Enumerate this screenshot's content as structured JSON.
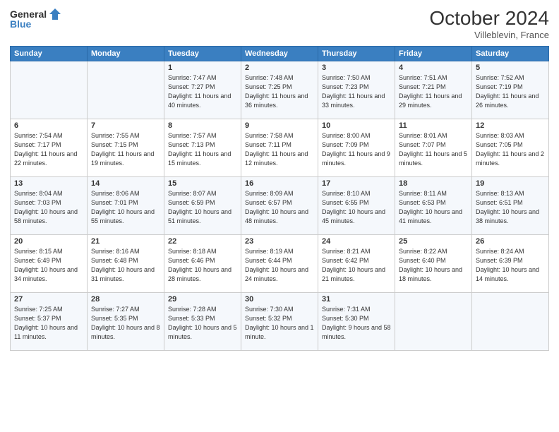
{
  "header": {
    "logo_line1": "General",
    "logo_line2": "Blue",
    "month": "October 2024",
    "location": "Villeblevin, France"
  },
  "weekdays": [
    "Sunday",
    "Monday",
    "Tuesday",
    "Wednesday",
    "Thursday",
    "Friday",
    "Saturday"
  ],
  "weeks": [
    [
      {
        "day": "",
        "sunrise": "",
        "sunset": "",
        "daylight": ""
      },
      {
        "day": "",
        "sunrise": "",
        "sunset": "",
        "daylight": ""
      },
      {
        "day": "1",
        "sunrise": "Sunrise: 7:47 AM",
        "sunset": "Sunset: 7:27 PM",
        "daylight": "Daylight: 11 hours and 40 minutes."
      },
      {
        "day": "2",
        "sunrise": "Sunrise: 7:48 AM",
        "sunset": "Sunset: 7:25 PM",
        "daylight": "Daylight: 11 hours and 36 minutes."
      },
      {
        "day": "3",
        "sunrise": "Sunrise: 7:50 AM",
        "sunset": "Sunset: 7:23 PM",
        "daylight": "Daylight: 11 hours and 33 minutes."
      },
      {
        "day": "4",
        "sunrise": "Sunrise: 7:51 AM",
        "sunset": "Sunset: 7:21 PM",
        "daylight": "Daylight: 11 hours and 29 minutes."
      },
      {
        "day": "5",
        "sunrise": "Sunrise: 7:52 AM",
        "sunset": "Sunset: 7:19 PM",
        "daylight": "Daylight: 11 hours and 26 minutes."
      }
    ],
    [
      {
        "day": "6",
        "sunrise": "Sunrise: 7:54 AM",
        "sunset": "Sunset: 7:17 PM",
        "daylight": "Daylight: 11 hours and 22 minutes."
      },
      {
        "day": "7",
        "sunrise": "Sunrise: 7:55 AM",
        "sunset": "Sunset: 7:15 PM",
        "daylight": "Daylight: 11 hours and 19 minutes."
      },
      {
        "day": "8",
        "sunrise": "Sunrise: 7:57 AM",
        "sunset": "Sunset: 7:13 PM",
        "daylight": "Daylight: 11 hours and 15 minutes."
      },
      {
        "day": "9",
        "sunrise": "Sunrise: 7:58 AM",
        "sunset": "Sunset: 7:11 PM",
        "daylight": "Daylight: 11 hours and 12 minutes."
      },
      {
        "day": "10",
        "sunrise": "Sunrise: 8:00 AM",
        "sunset": "Sunset: 7:09 PM",
        "daylight": "Daylight: 11 hours and 9 minutes."
      },
      {
        "day": "11",
        "sunrise": "Sunrise: 8:01 AM",
        "sunset": "Sunset: 7:07 PM",
        "daylight": "Daylight: 11 hours and 5 minutes."
      },
      {
        "day": "12",
        "sunrise": "Sunrise: 8:03 AM",
        "sunset": "Sunset: 7:05 PM",
        "daylight": "Daylight: 11 hours and 2 minutes."
      }
    ],
    [
      {
        "day": "13",
        "sunrise": "Sunrise: 8:04 AM",
        "sunset": "Sunset: 7:03 PM",
        "daylight": "Daylight: 10 hours and 58 minutes."
      },
      {
        "day": "14",
        "sunrise": "Sunrise: 8:06 AM",
        "sunset": "Sunset: 7:01 PM",
        "daylight": "Daylight: 10 hours and 55 minutes."
      },
      {
        "day": "15",
        "sunrise": "Sunrise: 8:07 AM",
        "sunset": "Sunset: 6:59 PM",
        "daylight": "Daylight: 10 hours and 51 minutes."
      },
      {
        "day": "16",
        "sunrise": "Sunrise: 8:09 AM",
        "sunset": "Sunset: 6:57 PM",
        "daylight": "Daylight: 10 hours and 48 minutes."
      },
      {
        "day": "17",
        "sunrise": "Sunrise: 8:10 AM",
        "sunset": "Sunset: 6:55 PM",
        "daylight": "Daylight: 10 hours and 45 minutes."
      },
      {
        "day": "18",
        "sunrise": "Sunrise: 8:11 AM",
        "sunset": "Sunset: 6:53 PM",
        "daylight": "Daylight: 10 hours and 41 minutes."
      },
      {
        "day": "19",
        "sunrise": "Sunrise: 8:13 AM",
        "sunset": "Sunset: 6:51 PM",
        "daylight": "Daylight: 10 hours and 38 minutes."
      }
    ],
    [
      {
        "day": "20",
        "sunrise": "Sunrise: 8:15 AM",
        "sunset": "Sunset: 6:49 PM",
        "daylight": "Daylight: 10 hours and 34 minutes."
      },
      {
        "day": "21",
        "sunrise": "Sunrise: 8:16 AM",
        "sunset": "Sunset: 6:48 PM",
        "daylight": "Daylight: 10 hours and 31 minutes."
      },
      {
        "day": "22",
        "sunrise": "Sunrise: 8:18 AM",
        "sunset": "Sunset: 6:46 PM",
        "daylight": "Daylight: 10 hours and 28 minutes."
      },
      {
        "day": "23",
        "sunrise": "Sunrise: 8:19 AM",
        "sunset": "Sunset: 6:44 PM",
        "daylight": "Daylight: 10 hours and 24 minutes."
      },
      {
        "day": "24",
        "sunrise": "Sunrise: 8:21 AM",
        "sunset": "Sunset: 6:42 PM",
        "daylight": "Daylight: 10 hours and 21 minutes."
      },
      {
        "day": "25",
        "sunrise": "Sunrise: 8:22 AM",
        "sunset": "Sunset: 6:40 PM",
        "daylight": "Daylight: 10 hours and 18 minutes."
      },
      {
        "day": "26",
        "sunrise": "Sunrise: 8:24 AM",
        "sunset": "Sunset: 6:39 PM",
        "daylight": "Daylight: 10 hours and 14 minutes."
      }
    ],
    [
      {
        "day": "27",
        "sunrise": "Sunrise: 7:25 AM",
        "sunset": "Sunset: 5:37 PM",
        "daylight": "Daylight: 10 hours and 11 minutes."
      },
      {
        "day": "28",
        "sunrise": "Sunrise: 7:27 AM",
        "sunset": "Sunset: 5:35 PM",
        "daylight": "Daylight: 10 hours and 8 minutes."
      },
      {
        "day": "29",
        "sunrise": "Sunrise: 7:28 AM",
        "sunset": "Sunset: 5:33 PM",
        "daylight": "Daylight: 10 hours and 5 minutes."
      },
      {
        "day": "30",
        "sunrise": "Sunrise: 7:30 AM",
        "sunset": "Sunset: 5:32 PM",
        "daylight": "Daylight: 10 hours and 1 minute."
      },
      {
        "day": "31",
        "sunrise": "Sunrise: 7:31 AM",
        "sunset": "Sunset: 5:30 PM",
        "daylight": "Daylight: 9 hours and 58 minutes."
      },
      {
        "day": "",
        "sunrise": "",
        "sunset": "",
        "daylight": ""
      },
      {
        "day": "",
        "sunrise": "",
        "sunset": "",
        "daylight": ""
      }
    ]
  ]
}
